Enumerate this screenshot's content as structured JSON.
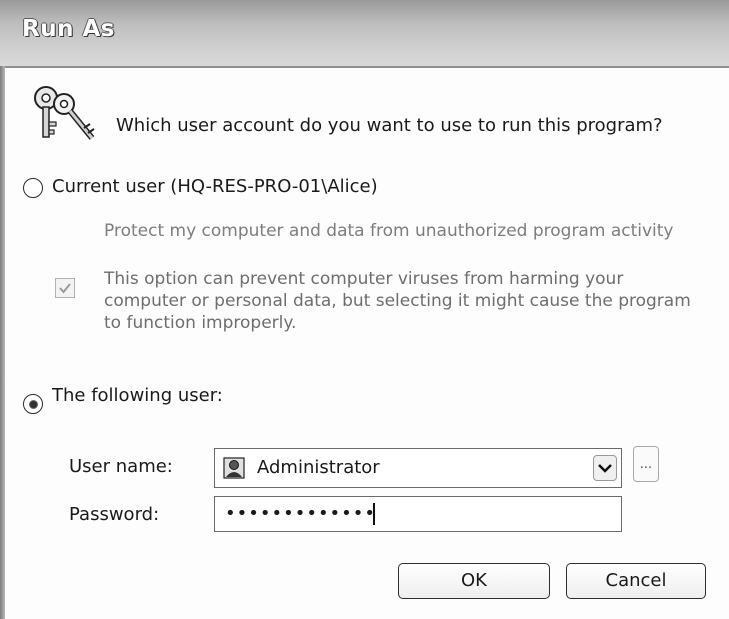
{
  "window": {
    "title": "Run As"
  },
  "prompt": "Which user account do you want to use to run this program?",
  "current_user": {
    "label": "Current user (HQ-RES-PRO-01\\Alice)",
    "selected": false,
    "protect_text": "Protect my computer and data from unauthorized program activity",
    "warning_text": "This option can prevent computer viruses from harming your computer or personal data, but selecting it might cause the program to function improperly.",
    "protect_checked": true
  },
  "following_user": {
    "label": "The following user:",
    "selected": true,
    "username_label": "User name:",
    "username_value": "Administrator",
    "browse_label": "...",
    "password_label": "Password:",
    "password_masked": "•••••••••••••"
  },
  "buttons": {
    "ok": "OK",
    "cancel": "Cancel"
  },
  "icons": {
    "title_icon": "keys-icon",
    "user_icon": "user-icon",
    "dropdown": "chevron-down-icon"
  }
}
